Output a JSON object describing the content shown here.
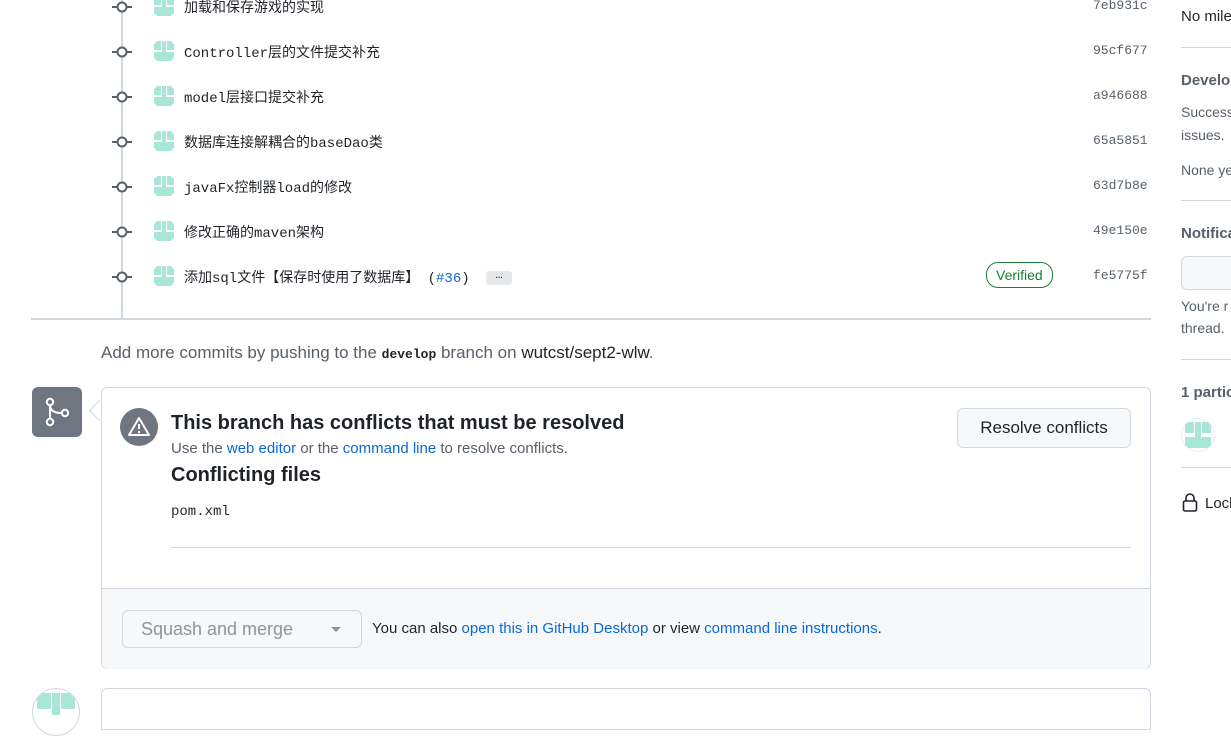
{
  "commits": [
    {
      "message": "加载和保存游戏的实现",
      "sha": "7eb931c"
    },
    {
      "message": "Controller层的文件提交补充",
      "sha": "95cf677"
    },
    {
      "message": "model层接口提交补充",
      "sha": "a946688"
    },
    {
      "message": "数据库连接解耦合的baseDao类",
      "sha": "65a5851"
    },
    {
      "message": "javaFx控制器load的修改",
      "sha": "63d7b8e"
    },
    {
      "message": "修改正确的maven架构",
      "sha": "49e150e"
    },
    {
      "message": "添加sql文件【保存时使用了数据库】 (",
      "link": "#36",
      "suffix": ")",
      "ellipsis": "…",
      "sha": "fe5775f",
      "badge": "Verified"
    }
  ],
  "add_more": {
    "prefix": "Add more commits by pushing to the ",
    "branch": "develop",
    "middle": " branch on ",
    "repo": "wutcst/sept2-wlw",
    "suffix": "."
  },
  "merge": {
    "title": "This branch has conflicts that must be resolved",
    "sub_prefix": "Use the ",
    "web_editor": "web editor",
    "sub_or": " or the ",
    "command_line": "command line",
    "sub_suffix": " to resolve conflicts.",
    "resolve_button": "Resolve conflicts",
    "conflicting_files_title": "Conflicting files",
    "files": [
      "pom.xml"
    ],
    "squash_button": "Squash and merge",
    "footer_prefix": "You can also ",
    "desktop_link": "open this in GitHub Desktop",
    "footer_middle": " or view ",
    "cli_link": "command line instructions",
    "footer_suffix": "."
  },
  "sidebar": {
    "milestone_none": "No mile",
    "development_title": "Develop",
    "development_text_1": "Success",
    "development_text_2": "issues.",
    "development_none": "None ye",
    "notifications_title": "Notifica",
    "notifications_text_1": "You're r",
    "notifications_text_2": "thread.",
    "participants": "1 partic",
    "lock": "Lock"
  },
  "colors": {
    "link": "#0969da",
    "verified": "#1a7f37",
    "identicon": "#a8e6d8"
  }
}
